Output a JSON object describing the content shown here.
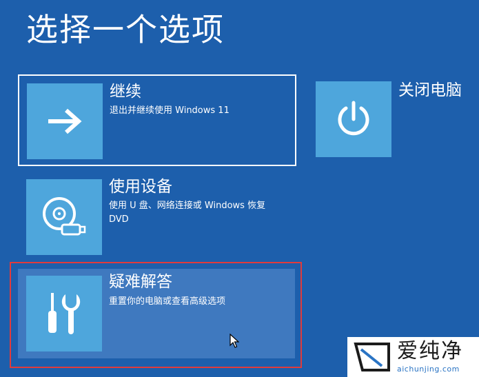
{
  "page": {
    "title": "选择一个选项"
  },
  "options": {
    "continue": {
      "title": "继续",
      "description": "退出并继续使用 Windows 11",
      "icon": "arrow-right-icon"
    },
    "power_off": {
      "title": "关闭电脑",
      "icon": "power-icon"
    },
    "use_device": {
      "title": "使用设备",
      "description": "使用 U 盘、网络连接或 Windows 恢复 DVD",
      "icon": "disc-usb-icon"
    },
    "troubleshoot": {
      "title": "疑难解答",
      "description": "重置你的电脑或查看高级选项",
      "icon": "tools-icon"
    }
  },
  "watermark": {
    "logo_text": "爱纯净",
    "url": "aichunjing.com"
  },
  "colors": {
    "background": "#1d5fac",
    "tile": "#4ea6dc",
    "hover": "#3f79bf",
    "highlight_border": "#e23b3b"
  }
}
